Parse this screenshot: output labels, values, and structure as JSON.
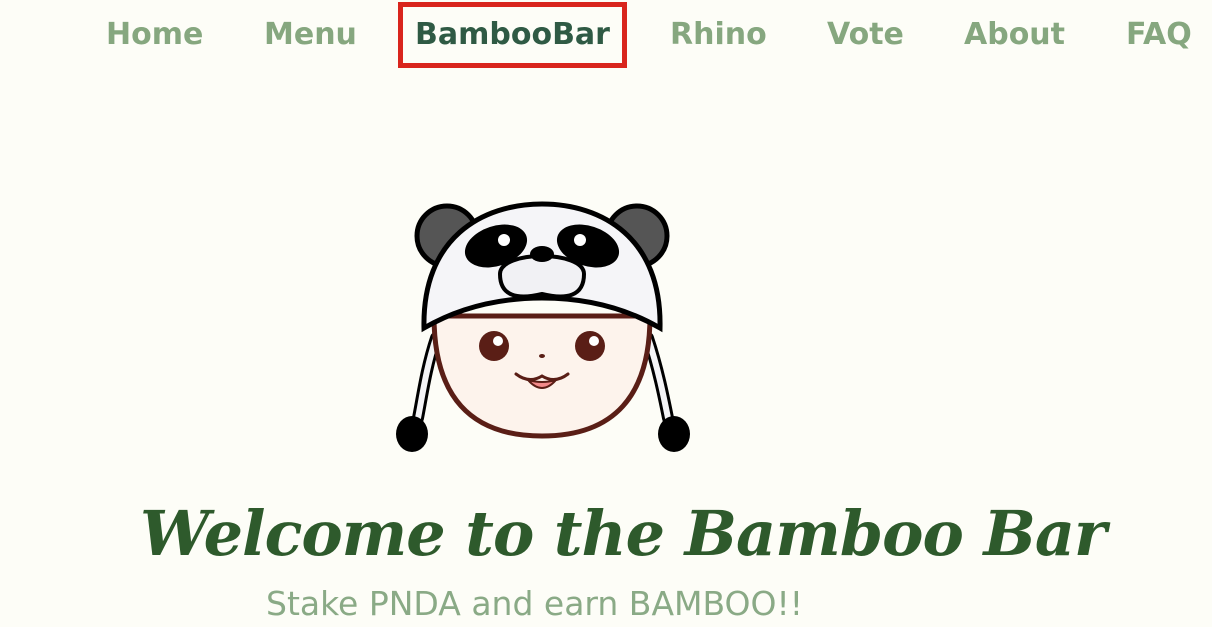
{
  "nav": {
    "items": [
      {
        "label": "Home",
        "active": false
      },
      {
        "label": "Menu",
        "active": false
      },
      {
        "label": "BambooBar",
        "active": true
      },
      {
        "label": "Rhino",
        "active": false
      },
      {
        "label": "Vote",
        "active": false
      },
      {
        "label": "About",
        "active": false
      },
      {
        "label": "FAQ",
        "active": false
      }
    ]
  },
  "hero": {
    "mascot_icon": "panda-hat-mascot-icon",
    "title": "Welcome to the Bamboo Bar",
    "subtitle": "Stake PNDA and earn BAMBOO!!"
  },
  "colors": {
    "background": "#fdfdf7",
    "nav_link": "#86a77f",
    "nav_active": "#2f5a44",
    "highlight_box": "#d9251d",
    "title": "#2e5a2c",
    "subtitle": "#8aaa86"
  }
}
